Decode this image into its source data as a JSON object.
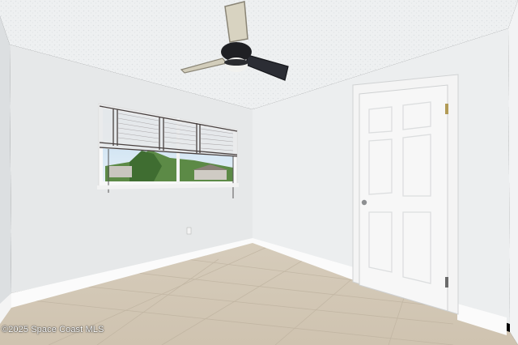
{
  "photo": {
    "description_tags": [
      "ceiling-fan",
      "window-with-blinds",
      "white-door",
      "tile-floor",
      "baseboard"
    ],
    "watermark": "©2025 Space Coast MLS"
  },
  "palette": {
    "ceiling": "#eef0f1",
    "left_wall": "#e7e9ea",
    "right_wall": "#e9ebec",
    "floor": "#d4c9b7",
    "baseboard": "#fafafa",
    "door": "#f7f7f7",
    "blinds": "#4a4346"
  }
}
